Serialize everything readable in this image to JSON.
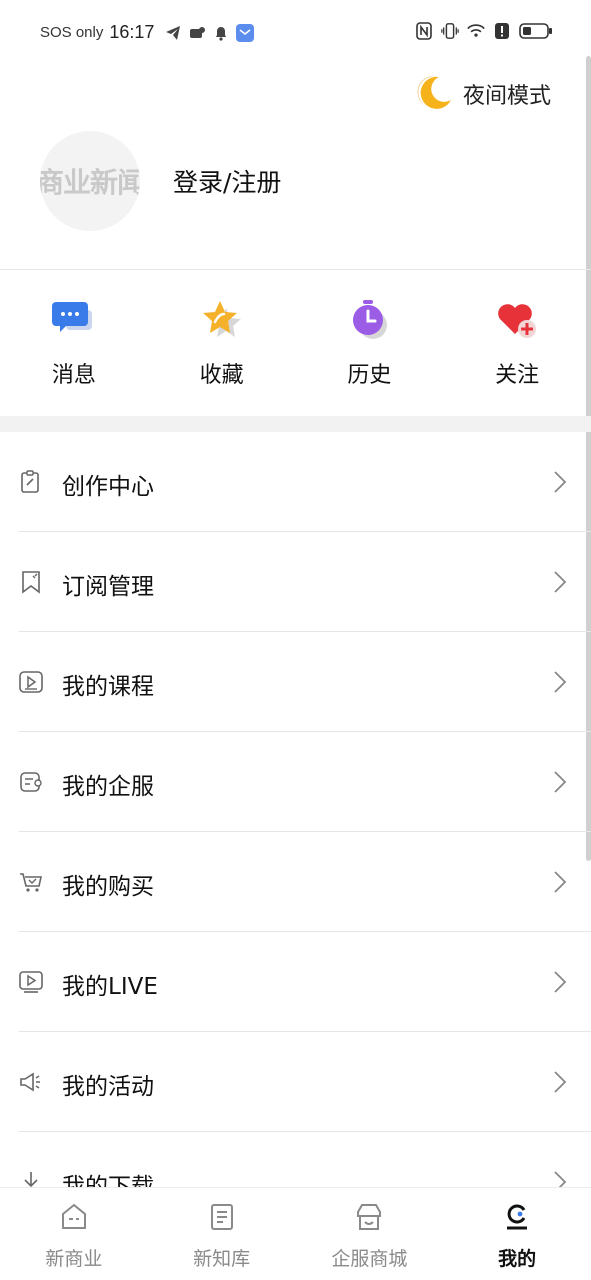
{
  "status_bar": {
    "carrier": "SOS only",
    "time": "16:17"
  },
  "header": {
    "night_mode_label": "夜间模式"
  },
  "profile": {
    "avatar_text": "商业新闻",
    "login_label": "登录/注册"
  },
  "quick_actions": [
    {
      "label": "消息",
      "icon": "message-icon",
      "color": "#3a7bea"
    },
    {
      "label": "收藏",
      "icon": "star-icon",
      "color": "#f5b12a"
    },
    {
      "label": "历史",
      "icon": "clock-icon",
      "color": "#9b5ce6"
    },
    {
      "label": "关注",
      "icon": "heart-plus-icon",
      "color": "#e8323a"
    }
  ],
  "menu": [
    {
      "label": "创作中心",
      "icon": "create-icon"
    },
    {
      "label": "订阅管理",
      "icon": "bookmark-icon"
    },
    {
      "label": "我的课程",
      "icon": "course-icon"
    },
    {
      "label": "我的企服",
      "icon": "service-icon"
    },
    {
      "label": "我的购买",
      "icon": "cart-icon"
    },
    {
      "label": "我的LIVE",
      "icon": "live-icon"
    },
    {
      "label": "我的活动",
      "icon": "megaphone-icon"
    },
    {
      "label": "我的下载",
      "icon": "download-icon"
    }
  ],
  "bottom_nav": [
    {
      "label": "新商业",
      "icon": "home-icon",
      "active": false
    },
    {
      "label": "新知库",
      "icon": "book-icon",
      "active": false
    },
    {
      "label": "企服商城",
      "icon": "shop-icon",
      "active": false
    },
    {
      "label": "我的",
      "icon": "profile-icon",
      "active": true
    }
  ],
  "colors": {
    "accent": "#3a7bea",
    "text": "#111111",
    "inactive": "#8a8a8a"
  }
}
